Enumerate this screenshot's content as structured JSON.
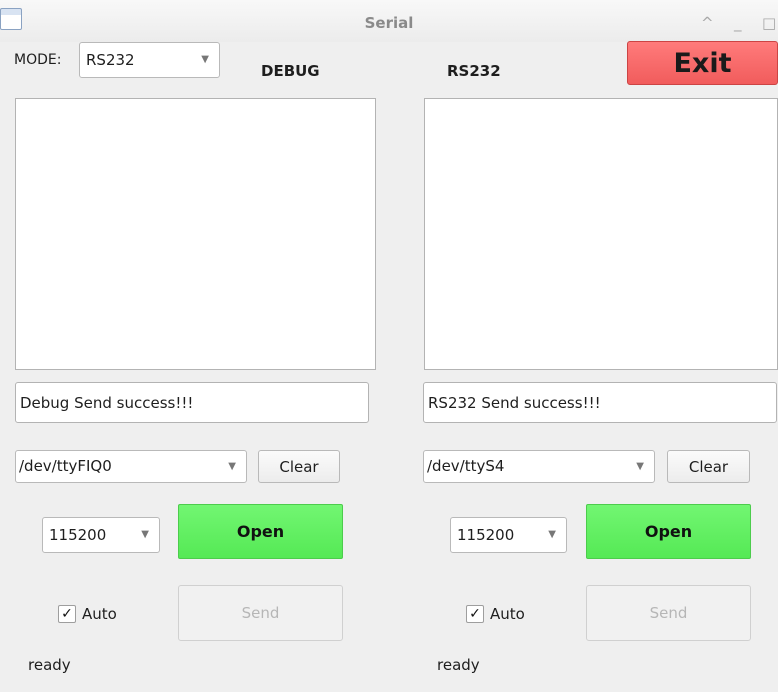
{
  "window": {
    "title": "Serial",
    "controls": [
      "^",
      "_",
      "□"
    ]
  },
  "mode": {
    "label": "MODE:",
    "selected": "RS232"
  },
  "exit_label": "Exit",
  "panels": [
    {
      "title": "DEBUG",
      "message": "Debug Send success!!!",
      "port": "/dev/ttyFIQ0",
      "clear_label": "Clear",
      "baud": "115200",
      "open_label": "Open",
      "auto_label": "Auto",
      "auto_checked": true,
      "send_label": "Send",
      "status": "ready"
    },
    {
      "title": "RS232",
      "message": "RS232 Send success!!!",
      "port": "/dev/ttyS4",
      "clear_label": "Clear",
      "baud": "115200",
      "open_label": "Open",
      "auto_label": "Auto",
      "auto_checked": true,
      "send_label": "Send",
      "status": "ready"
    }
  ],
  "colors": {
    "exit": "#f15c5c",
    "open": "#55e955",
    "background": "#efefef"
  }
}
